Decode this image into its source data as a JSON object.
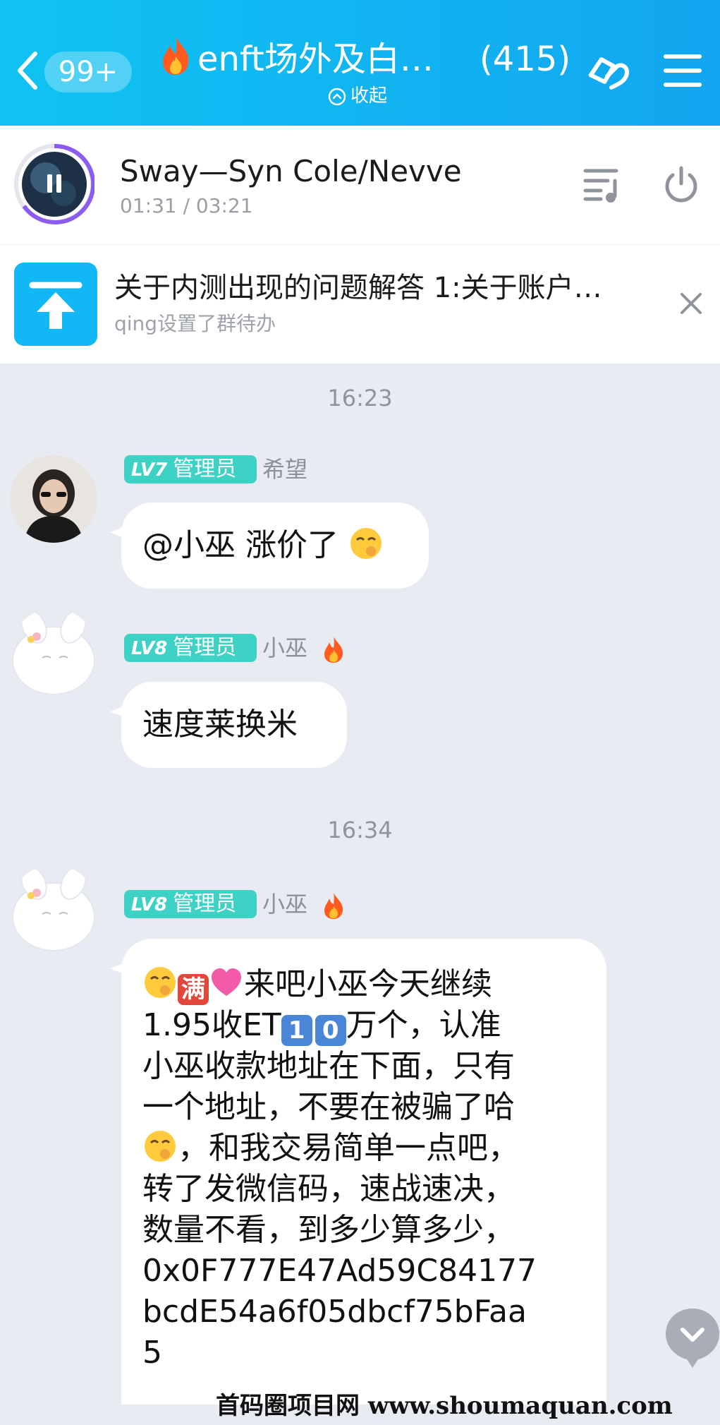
{
  "header": {
    "unread_badge": "99+",
    "title": "enft场外及白…",
    "member_count": "(415)",
    "collapse_label": "收起"
  },
  "music": {
    "song_title": "Sway—Syn Cole/Nevve",
    "time": "01:31 / 03:21"
  },
  "notice": {
    "text": "关于内测出现的问题解答 1:关于账户…",
    "subtitle": "qing设置了群待办"
  },
  "chat": {
    "times": [
      "16:23",
      "16:34"
    ],
    "messages": [
      {
        "level": "LV7",
        "role": "管理员",
        "sender": "希望",
        "text": "@小巫 涨价了"
      },
      {
        "level": "LV8",
        "role": "管理员",
        "sender": "小巫",
        "text": "速度莱换米"
      },
      {
        "level": "LV8",
        "role": "管理员",
        "sender": "小巫",
        "lines": [
          "满",
          "来吧小巫今天继续",
          "1.95收ET",
          "1",
          "0",
          "万个，认准",
          "小巫收款地址在下面，只有",
          "一个地址，不要在被骗了哈",
          "，和我交易简单一点吧，",
          "转了发微信码，速战速决，",
          "数量不看，到多少算多少，",
          "0x0F777E47Ad59C84177",
          "bcdE54a6f05dbcf75bFaa",
          "5"
        ]
      }
    ]
  },
  "watermark": "首码圈项目网 www.shoumaquan.com",
  "colors": {
    "header_start": "#10c3f2",
    "header_end": "#12a6f0",
    "badge": "#3ed2c6",
    "notice_icon": "#12b7f5",
    "chat_bg": "#e9ebf2"
  },
  "icons": [
    "back-arrow-icon",
    "link-icon",
    "menu-icon",
    "pause-icon",
    "playlist-icon",
    "power-icon",
    "pin-top-icon",
    "close-icon",
    "fire-icon",
    "scroll-down-icon"
  ]
}
